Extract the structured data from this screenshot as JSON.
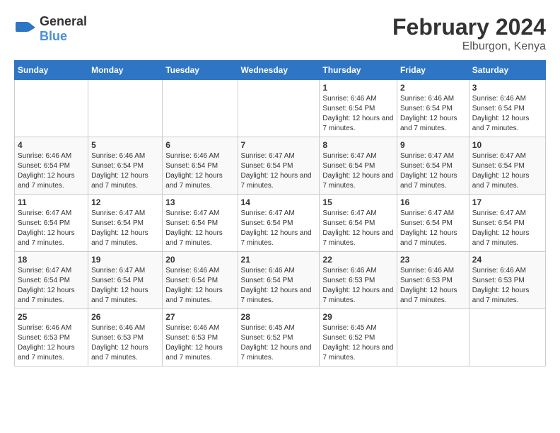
{
  "logo": {
    "text_general": "General",
    "text_blue": "Blue"
  },
  "title": "February 2024",
  "subtitle": "Elburgon, Kenya",
  "days_of_week": [
    "Sunday",
    "Monday",
    "Tuesday",
    "Wednesday",
    "Thursday",
    "Friday",
    "Saturday"
  ],
  "weeks": [
    [
      {
        "day": "",
        "info": ""
      },
      {
        "day": "",
        "info": ""
      },
      {
        "day": "",
        "info": ""
      },
      {
        "day": "",
        "info": ""
      },
      {
        "day": "1",
        "info": "Sunrise: 6:46 AM\nSunset: 6:54 PM\nDaylight: 12 hours and 7 minutes."
      },
      {
        "day": "2",
        "info": "Sunrise: 6:46 AM\nSunset: 6:54 PM\nDaylight: 12 hours and 7 minutes."
      },
      {
        "day": "3",
        "info": "Sunrise: 6:46 AM\nSunset: 6:54 PM\nDaylight: 12 hours and 7 minutes."
      }
    ],
    [
      {
        "day": "4",
        "info": "Sunrise: 6:46 AM\nSunset: 6:54 PM\nDaylight: 12 hours and 7 minutes."
      },
      {
        "day": "5",
        "info": "Sunrise: 6:46 AM\nSunset: 6:54 PM\nDaylight: 12 hours and 7 minutes."
      },
      {
        "day": "6",
        "info": "Sunrise: 6:46 AM\nSunset: 6:54 PM\nDaylight: 12 hours and 7 minutes."
      },
      {
        "day": "7",
        "info": "Sunrise: 6:47 AM\nSunset: 6:54 PM\nDaylight: 12 hours and 7 minutes."
      },
      {
        "day": "8",
        "info": "Sunrise: 6:47 AM\nSunset: 6:54 PM\nDaylight: 12 hours and 7 minutes."
      },
      {
        "day": "9",
        "info": "Sunrise: 6:47 AM\nSunset: 6:54 PM\nDaylight: 12 hours and 7 minutes."
      },
      {
        "day": "10",
        "info": "Sunrise: 6:47 AM\nSunset: 6:54 PM\nDaylight: 12 hours and 7 minutes."
      }
    ],
    [
      {
        "day": "11",
        "info": "Sunrise: 6:47 AM\nSunset: 6:54 PM\nDaylight: 12 hours and 7 minutes."
      },
      {
        "day": "12",
        "info": "Sunrise: 6:47 AM\nSunset: 6:54 PM\nDaylight: 12 hours and 7 minutes."
      },
      {
        "day": "13",
        "info": "Sunrise: 6:47 AM\nSunset: 6:54 PM\nDaylight: 12 hours and 7 minutes."
      },
      {
        "day": "14",
        "info": "Sunrise: 6:47 AM\nSunset: 6:54 PM\nDaylight: 12 hours and 7 minutes."
      },
      {
        "day": "15",
        "info": "Sunrise: 6:47 AM\nSunset: 6:54 PM\nDaylight: 12 hours and 7 minutes."
      },
      {
        "day": "16",
        "info": "Sunrise: 6:47 AM\nSunset: 6:54 PM\nDaylight: 12 hours and 7 minutes."
      },
      {
        "day": "17",
        "info": "Sunrise: 6:47 AM\nSunset: 6:54 PM\nDaylight: 12 hours and 7 minutes."
      }
    ],
    [
      {
        "day": "18",
        "info": "Sunrise: 6:47 AM\nSunset: 6:54 PM\nDaylight: 12 hours and 7 minutes."
      },
      {
        "day": "19",
        "info": "Sunrise: 6:47 AM\nSunset: 6:54 PM\nDaylight: 12 hours and 7 minutes."
      },
      {
        "day": "20",
        "info": "Sunrise: 6:46 AM\nSunset: 6:54 PM\nDaylight: 12 hours and 7 minutes."
      },
      {
        "day": "21",
        "info": "Sunrise: 6:46 AM\nSunset: 6:54 PM\nDaylight: 12 hours and 7 minutes."
      },
      {
        "day": "22",
        "info": "Sunrise: 6:46 AM\nSunset: 6:53 PM\nDaylight: 12 hours and 7 minutes."
      },
      {
        "day": "23",
        "info": "Sunrise: 6:46 AM\nSunset: 6:53 PM\nDaylight: 12 hours and 7 minutes."
      },
      {
        "day": "24",
        "info": "Sunrise: 6:46 AM\nSunset: 6:53 PM\nDaylight: 12 hours and 7 minutes."
      }
    ],
    [
      {
        "day": "25",
        "info": "Sunrise: 6:46 AM\nSunset: 6:53 PM\nDaylight: 12 hours and 7 minutes."
      },
      {
        "day": "26",
        "info": "Sunrise: 6:46 AM\nSunset: 6:53 PM\nDaylight: 12 hours and 7 minutes."
      },
      {
        "day": "27",
        "info": "Sunrise: 6:46 AM\nSunset: 6:53 PM\nDaylight: 12 hours and 7 minutes."
      },
      {
        "day": "28",
        "info": "Sunrise: 6:45 AM\nSunset: 6:52 PM\nDaylight: 12 hours and 7 minutes."
      },
      {
        "day": "29",
        "info": "Sunrise: 6:45 AM\nSunset: 6:52 PM\nDaylight: 12 hours and 7 minutes."
      },
      {
        "day": "",
        "info": ""
      },
      {
        "day": "",
        "info": ""
      }
    ]
  ]
}
